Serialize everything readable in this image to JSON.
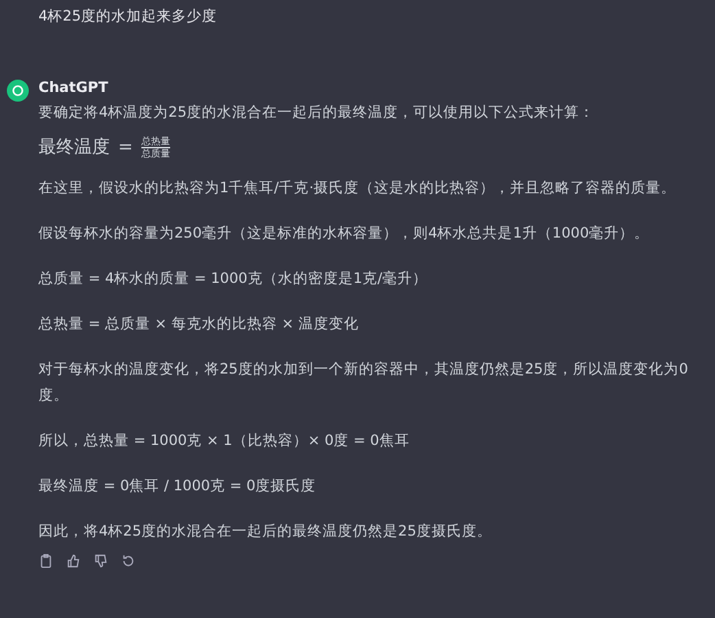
{
  "question": {
    "text": "4杯25度的水加起来多少度"
  },
  "answer": {
    "author": "ChatGPT",
    "intro": "要确定将4杯温度为25度的水混合在一起后的最终温度，可以使用以下公式来计算：",
    "formula": {
      "lhs": "最终温度",
      "op": "=",
      "numerator": "总热量",
      "denominator": "总质量"
    },
    "paragraphs": [
      "在这里，假设水的比热容为1千焦耳/千克·摄氏度（这是水的比热容），并且忽略了容器的质量。",
      "假设每杯水的容量为250毫升（这是标准的水杯容量），则4杯水总共是1升（1000毫升）。",
      "总质量 = 4杯水的质量 = 1000克（水的密度是1克/毫升）",
      "总热量 = 总质量 × 每克水的比热容 × 温度变化",
      "对于每杯水的温度变化，将25度的水加到一个新的容器中，其温度仍然是25度，所以温度变化为0度。",
      "所以，总热量 = 1000克 × 1（比热容）× 0度 = 0焦耳",
      "最终温度 = 0焦耳 / 1000克 = 0度摄氏度",
      "因此，将4杯25度的水混合在一起后的最终温度仍然是25度摄氏度。"
    ]
  }
}
